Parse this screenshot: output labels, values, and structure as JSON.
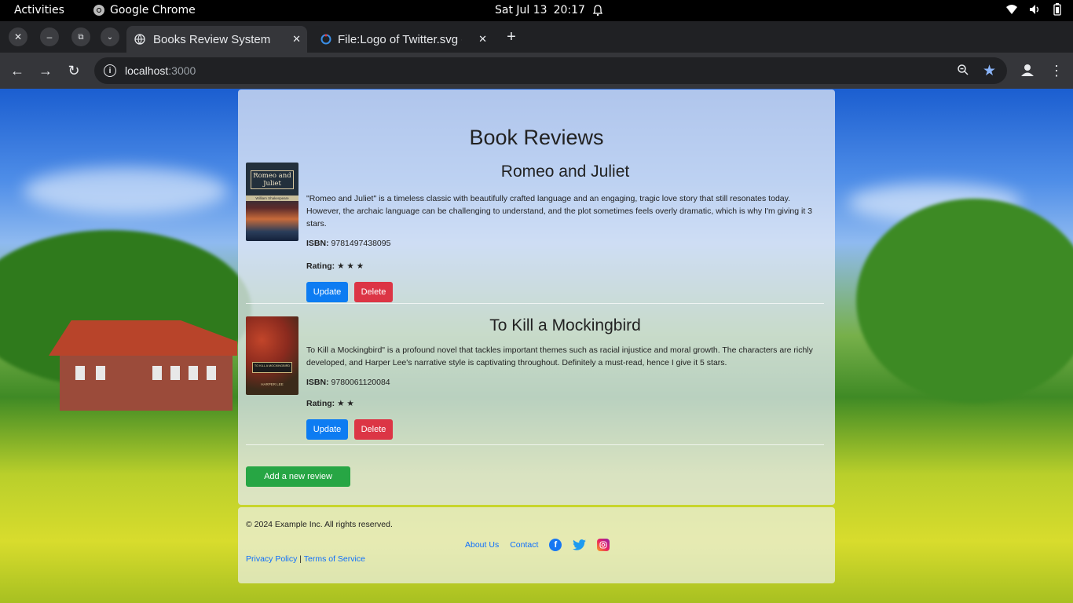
{
  "system_bar": {
    "activities": "Activities",
    "app": "Google Chrome",
    "date": "Sat Jul 13",
    "time": "20:17"
  },
  "browser": {
    "tabs": [
      {
        "title": "Books Review System",
        "active": true
      },
      {
        "title": "File:Logo of Twitter.svg -",
        "active": false
      }
    ],
    "url_host": "localhost",
    "url_port": ":3000",
    "new_tab": "+"
  },
  "page": {
    "heading": "Book Reviews",
    "reviews": [
      {
        "title": "Romeo and Juliet",
        "cover_title": "Romeo and Juliet",
        "cover_author": "William Shakespeare",
        "text": "\"Romeo and Juliet\" is a timeless classic with beautifully crafted language and an engaging, tragic love story that still resonates today. However, the archaic language can be challenging to understand, and the plot sometimes feels overly dramatic, which is why I'm giving it 3 stars.",
        "isbn_label": "ISBN:",
        "isbn": "9781497438095",
        "rating_label": "Rating:",
        "rating_stars": "★ ★ ★",
        "rating": 3,
        "update_label": "Update",
        "delete_label": "Delete"
      },
      {
        "title": "To Kill a Mockingbird",
        "cover_title": "TO KILL A MOCKINGBIRD",
        "cover_author": "HARPER LEE",
        "text": "To Kill a Mockingbird\" is a profound novel that tackles important themes such as racial injustice and moral growth. The characters are richly developed, and Harper Lee's narrative style is captivating throughout. Definitely a must-read, hence I give it 5 stars.",
        "isbn_label": "ISBN:",
        "isbn": "9780061120084",
        "rating_label": "Rating:",
        "rating_stars": "★ ★",
        "rating": 2,
        "update_label": "Update",
        "delete_label": "Delete"
      }
    ],
    "add_label": "Add a new review"
  },
  "footer": {
    "copyright": "© 2024 Example Inc. All rights reserved.",
    "about": "About Us",
    "contact": "Contact",
    "privacy": "Privacy Policy",
    "separator": "|",
    "terms": "Terms of Service"
  },
  "colors": {
    "primary": "#0d7cf2",
    "danger": "#dc3545",
    "success": "#27a644",
    "link": "#0d6efd"
  }
}
